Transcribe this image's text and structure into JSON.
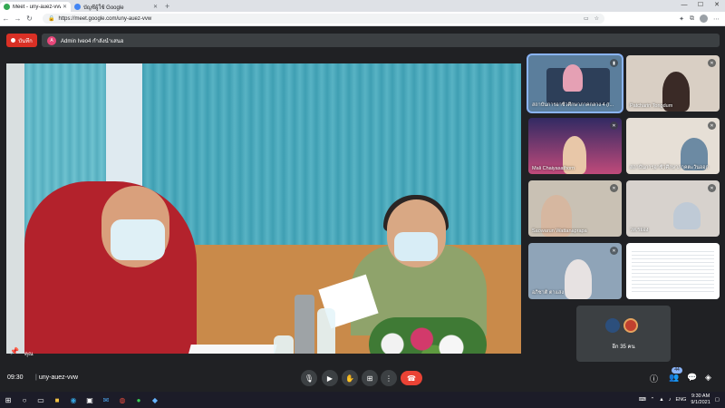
{
  "browser": {
    "tabs": [
      {
        "label": "Meet - uny-auez-vvw",
        "active": true,
        "favicon_color": "#34a853"
      },
      {
        "label": "บัญชีผู้ใช้ Google",
        "active": false,
        "favicon_color": "#4285f4"
      }
    ],
    "new_tab": "+",
    "url": "https://meet.google.com/uny-auez-vvw",
    "window_controls": {
      "minimize": "—",
      "maximize": "☐",
      "close": "✕"
    }
  },
  "meet": {
    "record_label": "บันทึก",
    "presenter_initial": "A",
    "presenter_text": "Admin Iveo4 กำลังนำเสนอ",
    "main_video_name": "คุณ",
    "participants": [
      {
        "label": "สถาบันการอาชีวศึกษาภาคกลาง 4 (I...",
        "active": true
      },
      {
        "label": "Patcharin Tongdum",
        "active": false
      },
      {
        "label": "Mali Chaiyasathorn",
        "active": false
      },
      {
        "label": "สถาบันการอาชีวศึกษาภาคตะวันออก",
        "active": false
      },
      {
        "label": "Saowarun Wattanaprapa",
        "active": false
      },
      {
        "label": "วท.รยอง",
        "active": false
      },
      {
        "label": "อภิชาติ ตาแสง",
        "active": false
      },
      {
        "label": "",
        "active": false
      }
    ],
    "others_text": "อีก 35 คน",
    "meeting_time": "09:30",
    "meeting_code": "uny-auez-vvw",
    "participants_count": "44",
    "colors": {
      "end_call": "#ea4335",
      "record": "#d93025",
      "accent": "#8ab4f8"
    }
  },
  "taskbar": {
    "language": "ENG",
    "time": "9:30 AM",
    "date": "9/1/2021"
  }
}
